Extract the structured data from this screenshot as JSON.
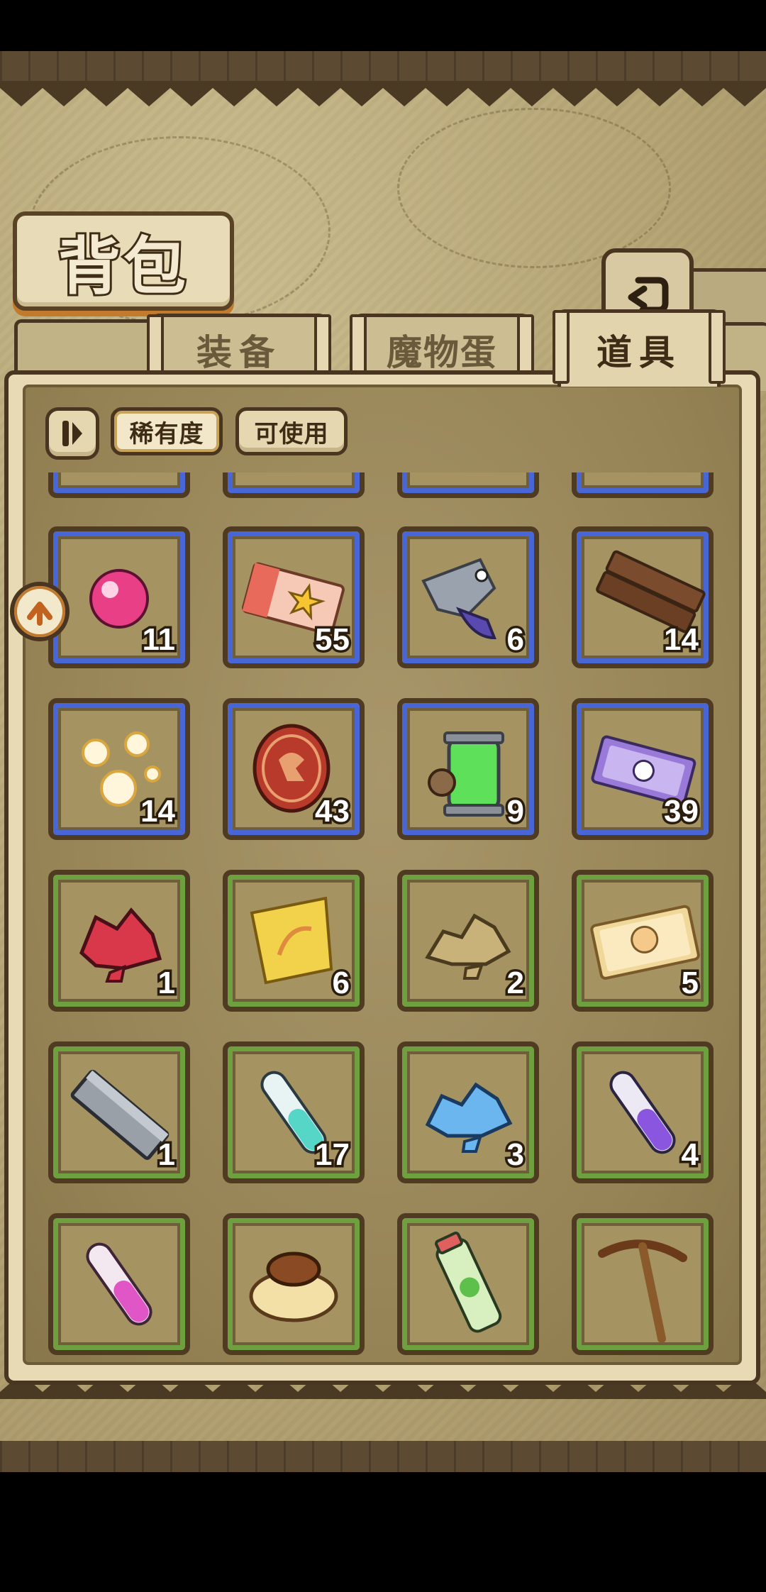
{
  "title": "背包",
  "tabs": [
    {
      "label": "装备",
      "active": false
    },
    {
      "label": "魔物蛋",
      "active": false
    },
    {
      "label": "道具",
      "active": true
    }
  ],
  "filters": {
    "rarity_label": "稀有度",
    "usable_label": "可使用"
  },
  "colors": {
    "rare_border": "#4866d6",
    "common_border": "#6fa040",
    "panel": "#9c8a5e",
    "wood": "#4a3620"
  },
  "items": [
    {
      "icon": "pink-orb-icon",
      "count": "11",
      "rarity": "rare"
    },
    {
      "icon": "star-ticket-icon",
      "count": "55",
      "rarity": "rare"
    },
    {
      "icon": "steel-fish-icon",
      "count": "6",
      "rarity": "rare"
    },
    {
      "icon": "wood-planks-icon",
      "count": "14",
      "rarity": "rare"
    },
    {
      "icon": "golden-bubbles-icon",
      "count": "14",
      "rarity": "rare"
    },
    {
      "icon": "red-emblem-coin-icon",
      "count": "43",
      "rarity": "rare"
    },
    {
      "icon": "green-canister-icon",
      "count": "9",
      "rarity": "rare"
    },
    {
      "icon": "purple-ticket-icon",
      "count": "39",
      "rarity": "rare"
    },
    {
      "icon": "red-crystal-icon",
      "count": "1",
      "rarity": "common"
    },
    {
      "icon": "golden-cloth-icon",
      "count": "6",
      "rarity": "common"
    },
    {
      "icon": "sand-ore-icon",
      "count": "2",
      "rarity": "common"
    },
    {
      "icon": "portrait-ticket-icon",
      "count": "5",
      "rarity": "common"
    },
    {
      "icon": "iron-ingot-icon",
      "count": "1",
      "rarity": "common"
    },
    {
      "icon": "cyan-test-tube-icon",
      "count": "17",
      "rarity": "common"
    },
    {
      "icon": "blue-crystal-icon",
      "count": "3",
      "rarity": "common"
    },
    {
      "icon": "purple-test-tube-icon",
      "count": "4",
      "rarity": "common"
    },
    {
      "icon": "pink-test-tube-icon",
      "count": "",
      "rarity": "common"
    },
    {
      "icon": "pudding-icon",
      "count": "",
      "rarity": "common"
    },
    {
      "icon": "green-drink-bottle-icon",
      "count": "",
      "rarity": "common"
    },
    {
      "icon": "pickaxe-icon",
      "count": "",
      "rarity": "common"
    }
  ]
}
